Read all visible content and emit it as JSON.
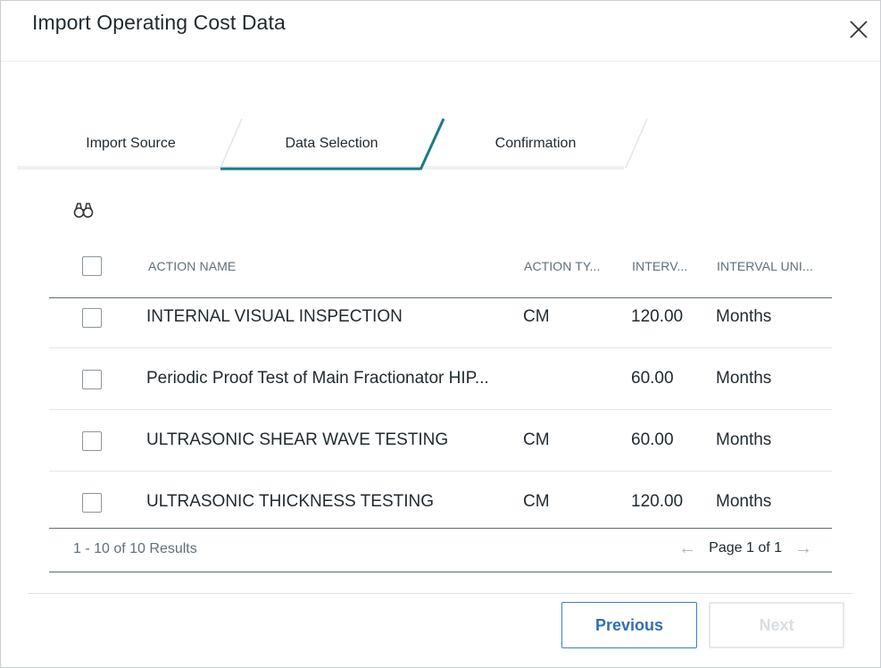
{
  "dialog": {
    "title": "Import Operating Cost Data",
    "close_icon": "close-icon"
  },
  "steps": [
    {
      "label": "Import Source",
      "active": false
    },
    {
      "label": "Data Selection",
      "active": true
    },
    {
      "label": "Confirmation",
      "active": false
    }
  ],
  "toolbar": {
    "search_icon": "binoculars-icon"
  },
  "table": {
    "columns": [
      "ACTION NAME",
      "ACTION TY...",
      "INTERV...",
      "INTERVAL UNI..."
    ],
    "rows": [
      {
        "name": "INTERNAL VISUAL INSPECTION",
        "type": "CM",
        "interval": "120.00",
        "unit": "Months",
        "checked": false
      },
      {
        "name": "Periodic Proof Test of Main Fractionator HIP...",
        "type": "",
        "interval": "60.00",
        "unit": "Months",
        "checked": false
      },
      {
        "name": "ULTRASONIC SHEAR WAVE TESTING",
        "type": "CM",
        "interval": "60.00",
        "unit": "Months",
        "checked": false
      },
      {
        "name": "ULTRASONIC THICKNESS TESTING",
        "type": "CM",
        "interval": "120.00",
        "unit": "Months",
        "checked": false
      }
    ]
  },
  "pagination": {
    "results": "1 - 10 of 10 Results",
    "page": "Page 1 of 1",
    "prev_icon": "arrow-left-icon",
    "next_icon": "arrow-right-icon"
  },
  "buttons": {
    "previous": "Previous",
    "next": "Next",
    "next_enabled": false
  },
  "colors": {
    "accent": "#1b7a8c",
    "primary_button": "#3b7fc4",
    "header_text": "#5f6e78"
  }
}
